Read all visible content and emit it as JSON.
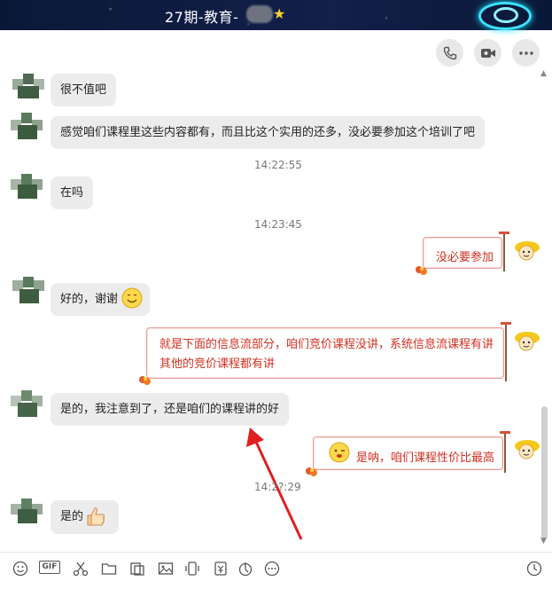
{
  "window": {
    "title": "27期-教育-"
  },
  "header": {
    "buttons": [
      "phone-icon",
      "video-icon",
      "more-icon"
    ]
  },
  "messages": [
    {
      "side": "left",
      "text": "很不值吧"
    },
    {
      "side": "left",
      "text": "感觉咱们课程里这些内容都有，而且比这个实用的还多，没必要参加这个培训了吧"
    },
    {
      "time": "14:22:55"
    },
    {
      "side": "left",
      "text": "在吗"
    },
    {
      "time": "14:23:45"
    },
    {
      "side": "right",
      "text": "没必要参加"
    },
    {
      "side": "left",
      "text": "好的，谢谢"
    },
    {
      "side": "right",
      "lines": [
        "就是下面的信息流部分，咱们竞价课程没讲，系统信息流课程有讲",
        "其他的竞价课程都有讲"
      ]
    },
    {
      "side": "left",
      "text": "是的，我注意到了，还是咱们的课程讲的好"
    },
    {
      "side": "right",
      "text": "是呐，咱们课程性价比最高"
    },
    {
      "time": "14:2?:29"
    },
    {
      "side": "left",
      "text": "是的"
    }
  ],
  "toolbar": {
    "icons": [
      "emoji-icon",
      "gif-icon",
      "scissors-icon",
      "folder-icon",
      "screenshot-icon",
      "image-icon",
      "shake-icon",
      "red-packet-icon",
      "voice-icon",
      "more-icon",
      "history-icon"
    ],
    "gif_label": "GIF"
  },
  "colors": {
    "header_bg": "#0b1a3a",
    "bubble_left": "#ececec",
    "bubble_right_text": "#d23020",
    "accent_logo": "#3fe2ff"
  }
}
